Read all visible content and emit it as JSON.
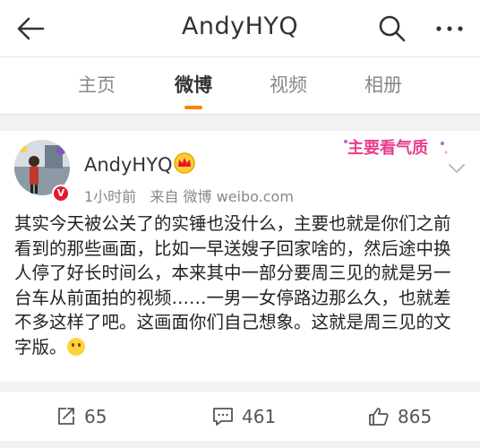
{
  "header": {
    "title": "AndyHYQ",
    "back_icon": "arrow-left-icon",
    "search_icon": "search-icon",
    "more_icon": "more-horizontal-icon"
  },
  "tabs": [
    {
      "label": "主页",
      "active": false
    },
    {
      "label": "微博",
      "active": true
    },
    {
      "label": "视频",
      "active": false
    },
    {
      "label": "相册",
      "active": false
    }
  ],
  "accent_color": "#ff8200",
  "post": {
    "author": "AndyHYQ",
    "author_badge": "crown-icon",
    "verified_badge": "V",
    "time": "1小时前",
    "source": "来自 微博 weibo.com",
    "decoration_text": "主要看气质",
    "text": "其实今天被公关了的实锤也没什么，主要也就是你们之前看到的那些画面，比如一早送嫂子回家啥的，然后途中换人停了好长时间么，本来其中一部分要周三见的就是另一台车从前面拍的视频……一男一女停路边那么久，也就差不多这样了吧。这画面你们自己想象。这就是周三见的文字版。",
    "emoji": "grin-emoji",
    "stats": {
      "reposts": "65",
      "comments": "461",
      "likes": "865"
    }
  }
}
